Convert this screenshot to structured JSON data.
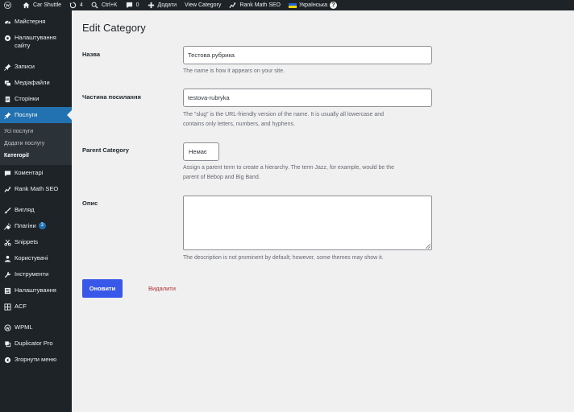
{
  "adminbar": {
    "site_name": "Car Shuttle",
    "updates_count": "4",
    "shortcut": "Ctrl+K",
    "comments_count": "0",
    "add_new": "Додати",
    "view_category": "View Category",
    "rank_math": "Rank Math SEO",
    "language": "Українська",
    "help": "?"
  },
  "sidebar": {
    "items": [
      {
        "label": "Майстерня",
        "icon": "dashboard-icon"
      },
      {
        "label": "Налаштування сайту",
        "icon": "settings-circle-icon"
      },
      {
        "label": "Записи",
        "icon": "pin-icon"
      },
      {
        "label": "Медіафайли",
        "icon": "media-icon"
      },
      {
        "label": "Сторінки",
        "icon": "page-icon"
      },
      {
        "label": "Послуги",
        "icon": "pin-icon"
      },
      {
        "label": "Коментарі",
        "icon": "comment-icon"
      },
      {
        "label": "Rank Math SEO",
        "icon": "rankmath-icon"
      },
      {
        "label": "Вигляд",
        "icon": "brush-icon"
      },
      {
        "label": "Плагіни",
        "icon": "plugin-icon",
        "badge": "3"
      },
      {
        "label": "Snippets",
        "icon": "scissors-icon"
      },
      {
        "label": "Користувачі",
        "icon": "user-icon"
      },
      {
        "label": "Інструменти",
        "icon": "wrench-icon"
      },
      {
        "label": "Налаштування",
        "icon": "sliders-icon"
      },
      {
        "label": "ACF",
        "icon": "grid-icon"
      },
      {
        "label": "WPML",
        "icon": "wpml-icon"
      },
      {
        "label": "Duplicator Pro",
        "icon": "duplicator-icon"
      },
      {
        "label": "Згорнути меню",
        "icon": "collapse-icon"
      }
    ],
    "submenu": [
      "Усі послуги",
      "Додати послугу",
      "Категорії"
    ]
  },
  "page": {
    "title": "Edit Category",
    "name_label": "Назва",
    "name_value": "Тестова рубрика",
    "name_desc": "The name is how it appears on your site.",
    "slug_label": "Частина посилання",
    "slug_value": "testova-rubryka",
    "slug_desc_1": "The “slug” is the URL-friendly version of the name. It is usually all lowercase and",
    "slug_desc_2": "contains only letters, numbers, and hyphens.",
    "parent_label": "Parent Category",
    "parent_value": "Немає",
    "parent_desc_1": "Assign a parent term to create a hierarchy. The term Jazz, for example, would be the",
    "parent_desc_2": "parent of Bebop and Big Band.",
    "desc_label": "Опис",
    "desc_value": "",
    "desc_help": "The description is not prominent by default; however, some themes may show it.",
    "update_button": "Оновити",
    "delete_link": "Видалити"
  }
}
